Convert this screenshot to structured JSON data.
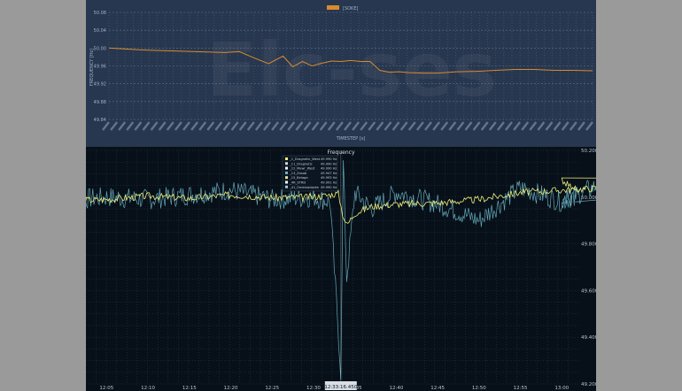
{
  "chart_data": [
    {
      "type": "line",
      "title": "",
      "legend": {
        "position": "top-center",
        "entries": [
          "[SOKE]"
        ]
      },
      "xlabel": "TIMESTEP [s]",
      "ylabel": "FREQUENCY [Hz]",
      "ylim": [
        49.84,
        50.08
      ],
      "yticks": [
        "50.08",
        "50.04",
        "50.00",
        "49.96",
        "49.92",
        "49.88",
        "49.84"
      ],
      "watermark": "Elc-ses",
      "grid": true,
      "series": [
        {
          "name": "[SOKE]",
          "color": "#d98a2e",
          "x": [
            0,
            0.03,
            0.06,
            0.09,
            0.12,
            0.15,
            0.18,
            0.21,
            0.24,
            0.27,
            0.3,
            0.33,
            0.36,
            0.38,
            0.4,
            0.42,
            0.44,
            0.46,
            0.48,
            0.5,
            0.52,
            0.54,
            0.56,
            0.58,
            0.6,
            0.62,
            0.65,
            0.68,
            0.72,
            0.76,
            0.8,
            0.84,
            0.88,
            0.92,
            0.96,
            1.0
          ],
          "values": [
            50.0,
            49.998,
            49.996,
            49.995,
            49.994,
            49.993,
            49.992,
            49.991,
            49.99,
            49.992,
            49.978,
            49.965,
            49.982,
            49.958,
            49.97,
            49.96,
            49.966,
            49.971,
            49.97,
            49.972,
            49.97,
            49.97,
            49.95,
            49.946,
            49.947,
            49.945,
            49.944,
            49.944,
            49.947,
            49.948,
            49.95,
            49.952,
            49.952,
            49.95,
            49.95,
            49.949
          ]
        }
      ]
    },
    {
      "type": "line",
      "title": "Frequency",
      "legend": {
        "position": "top-center",
        "entries": [
          {
            "label": "_1_Dragnetic_West",
            "value": "49.990 Hz",
            "color": "#f0f07a"
          },
          {
            "label": "_11_Dragnetic",
            "value": "49.990 Hz",
            "color": "#d8d8d8"
          },
          {
            "label": "_12_Mawr_West",
            "value": "49.990 Hz",
            "color": "#f7f7f7"
          },
          {
            "label": "_13_Zasab",
            "value": "49.947 Hz",
            "color": "#6fb7c8"
          },
          {
            "label": "_15_Belaga",
            "value": "49.993 Hz",
            "color": "#e6e6a0"
          },
          {
            "label": "_4R_STRD",
            "value": "49.991 Hz",
            "color": "#ffffff"
          },
          {
            "label": "_41_Ombinadzeke",
            "value": "49.990 Hz",
            "color": "#9ec9d4"
          }
        ]
      },
      "ylim": [
        49.2,
        50.2
      ],
      "yticks": [
        "50.200",
        "50.000",
        "49.800",
        "49.600",
        "49.400",
        "49.200"
      ],
      "xticks": [
        "12:05",
        "12:10",
        "12:15",
        "12:20",
        "12:25",
        "12:30",
        "12:35",
        "12:40",
        "12:45",
        "12:50",
        "12:55",
        "13:00"
      ],
      "cursor_time": "12:33:16.450",
      "grid": true,
      "series": [
        {
          "name": "_1_Dragnetic_West",
          "color": "#f0f07a",
          "x": [
            12.0,
            12.05,
            12.1,
            12.15,
            12.2,
            12.25,
            12.3,
            12.33,
            12.335,
            12.34,
            12.35,
            12.37,
            12.4,
            12.45,
            12.5,
            12.55,
            12.6,
            12.65,
            12.7,
            12.75,
            12.8,
            12.85,
            12.9,
            12.95,
            13.0,
            13.02
          ],
          "values": [
            49.985,
            49.99,
            50.005,
            49.995,
            50.01,
            49.998,
            50.0,
            50.015,
            49.93,
            49.88,
            49.93,
            49.96,
            49.97,
            49.975,
            49.99,
            50.02,
            50.03,
            50.04,
            50.04,
            50.05,
            50.06,
            50.06,
            50.065,
            50.07,
            50.07,
            50.02
          ]
        },
        {
          "name": "_13_Zasab",
          "color": "#6fb7c8",
          "x": [
            12.0,
            12.05,
            12.1,
            12.15,
            12.2,
            12.25,
            12.3,
            12.32,
            12.333,
            12.336,
            12.34,
            12.35,
            12.37,
            12.4,
            12.45,
            12.5,
            12.55,
            12.6,
            12.65,
            12.7,
            12.75,
            12.8,
            12.85,
            12.9,
            12.95,
            13.0,
            13.02
          ],
          "values": [
            49.985,
            50.0,
            49.99,
            50.01,
            50.03,
            49.99,
            50.0,
            49.98,
            49.25,
            50.15,
            49.65,
            50.02,
            49.95,
            50.02,
            49.97,
            49.9,
            50.04,
            49.98,
            50.06,
            49.97,
            50.02,
            49.98,
            50.05,
            49.99,
            50.04,
            49.98,
            50.01
          ]
        }
      ]
    }
  ]
}
